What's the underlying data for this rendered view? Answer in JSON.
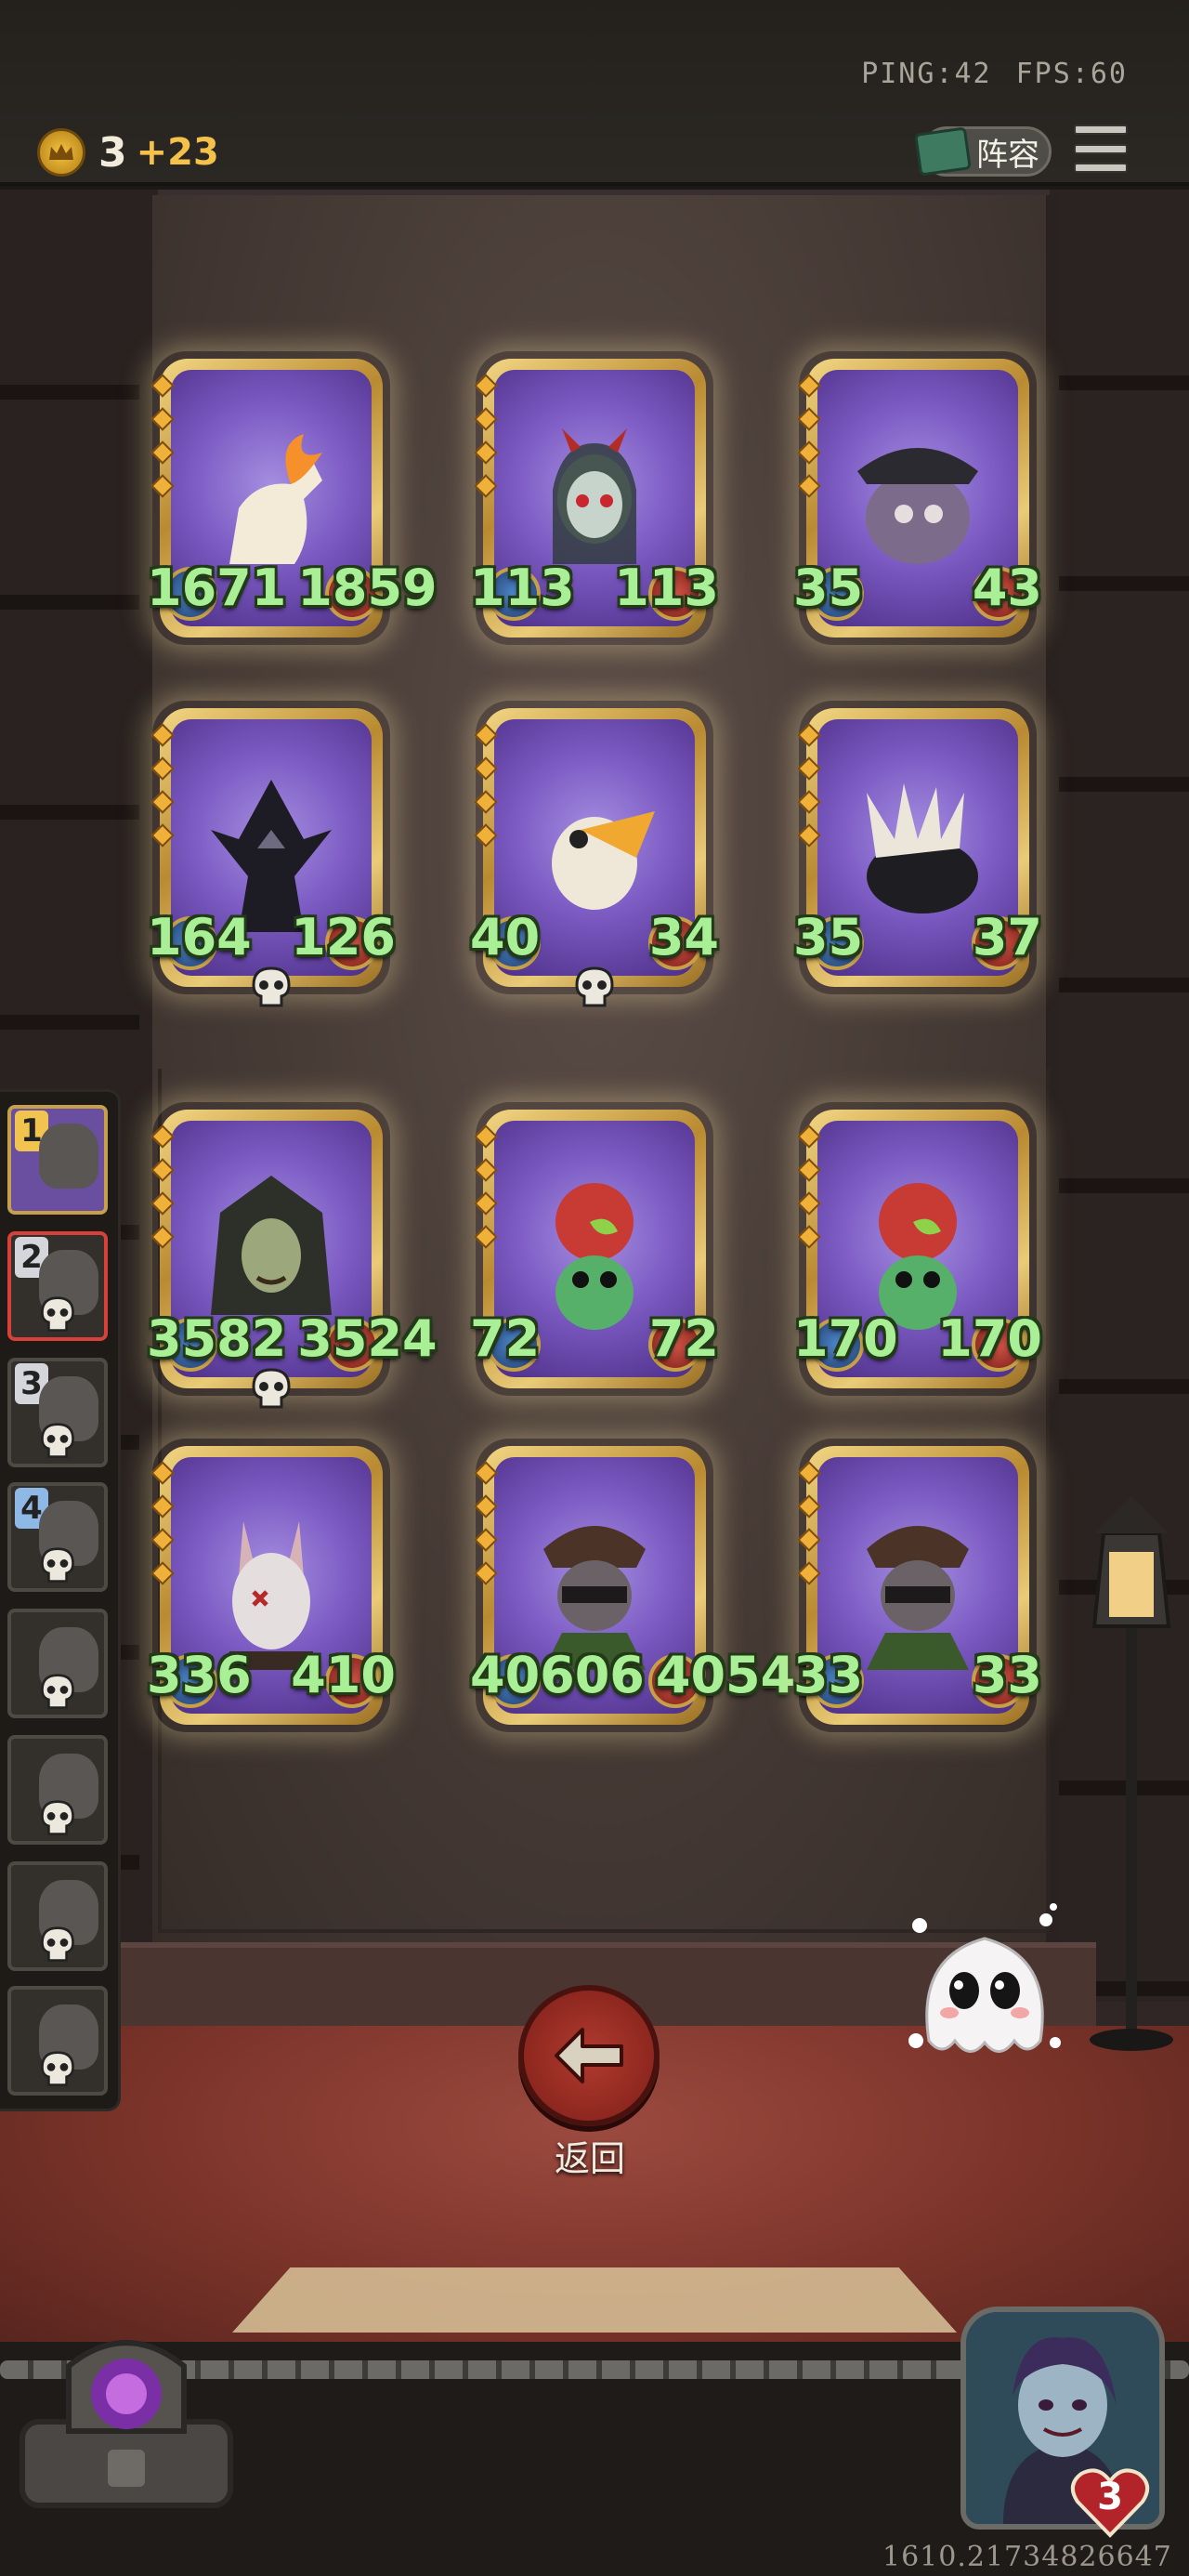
{
  "hud": {
    "ping": "PING:42",
    "fps": "FPS:60",
    "gold": "3",
    "gold_income": "+23",
    "lineup_label": "阵容",
    "menu_icon": "hamburger-menu-icon"
  },
  "board": {
    "cards": [
      {
        "name": "flame-horse",
        "attack": "1671",
        "health": "1859",
        "bg": "#7d5cc4"
      },
      {
        "name": "horned-elf",
        "attack": "113",
        "health": "113",
        "bg": "#7d5cc4"
      },
      {
        "name": "pirate-octopus",
        "attack": "35",
        "health": "43",
        "bg": "#7d5cc4"
      },
      {
        "name": "dark-knight",
        "attack": "164",
        "health": "126",
        "bg": "#7d5cc4"
      },
      {
        "name": "pelican",
        "attack": "40",
        "health": "34",
        "bg": "#7d5cc4"
      },
      {
        "name": "porcupine",
        "attack": "35",
        "health": "37",
        "bg": "#7d5cc4"
      },
      {
        "name": "witch",
        "attack": "3582",
        "health": "3524",
        "bg": "#7d5cc4"
      },
      {
        "name": "frog-apple",
        "attack": "72",
        "health": "72",
        "bg": "#7d5cc4"
      },
      {
        "name": "frog-apple",
        "attack": "170",
        "health": "170",
        "bg": "#7d5cc4"
      },
      {
        "name": "masked-rabbit",
        "attack": "336",
        "health": "410",
        "bg": "#7d5cc4"
      },
      {
        "name": "raccoon-bandit",
        "attack": "40606",
        "health": "40541",
        "bg": "#7d5cc4"
      },
      {
        "name": "raccoon-bandit",
        "attack": "33",
        "health": "33",
        "bg": "#7d5cc4"
      }
    ]
  },
  "queue": {
    "slots": [
      {
        "number": "1",
        "color": "gold"
      },
      {
        "number": "2",
        "color": "silver"
      },
      {
        "number": "3",
        "color": "silver"
      },
      {
        "number": "4",
        "color": "blue"
      },
      {
        "number": ""
      },
      {
        "number": ""
      },
      {
        "number": ""
      },
      {
        "number": ""
      }
    ]
  },
  "back_button": {
    "label": "返回"
  },
  "player": {
    "hp": "3"
  },
  "coordinate": "1610.21734826647"
}
